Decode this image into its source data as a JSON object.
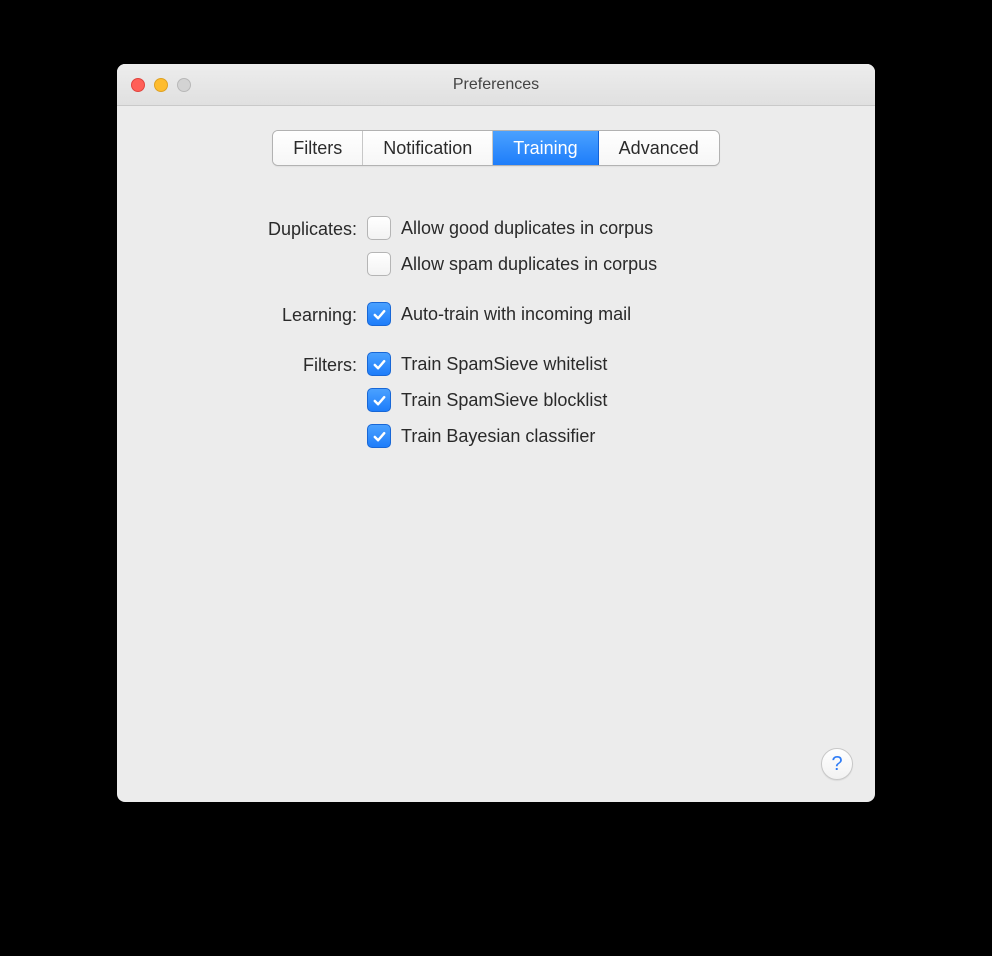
{
  "window": {
    "title": "Preferences"
  },
  "tabs": {
    "filters": "Filters",
    "notification": "Notification",
    "training": "Training",
    "advanced": "Advanced",
    "active": "training"
  },
  "sections": {
    "duplicates": {
      "label": "Duplicates:",
      "items": [
        {
          "label": "Allow good duplicates in corpus",
          "checked": false
        },
        {
          "label": "Allow spam duplicates in corpus",
          "checked": false
        }
      ]
    },
    "learning": {
      "label": "Learning:",
      "items": [
        {
          "label": "Auto-train with incoming mail",
          "checked": true
        }
      ]
    },
    "filters": {
      "label": "Filters:",
      "items": [
        {
          "label": "Train SpamSieve whitelist",
          "checked": true
        },
        {
          "label": "Train SpamSieve blocklist",
          "checked": true
        },
        {
          "label": "Train Bayesian classifier",
          "checked": true
        }
      ]
    }
  },
  "help": {
    "glyph": "?"
  }
}
